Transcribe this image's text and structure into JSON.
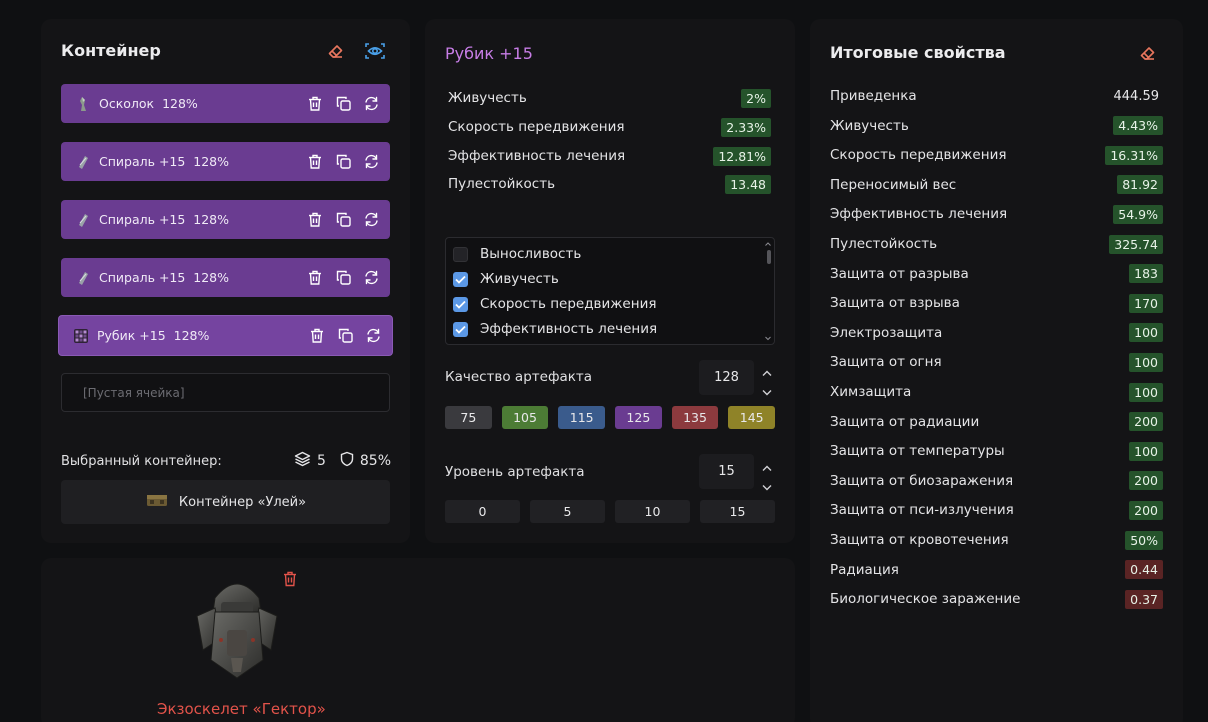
{
  "container": {
    "title": "Контейнер",
    "slots": [
      {
        "name": "Осколок",
        "percent": "128%"
      },
      {
        "name": "Спираль +15",
        "percent": "128%"
      },
      {
        "name": "Спираль +15",
        "percent": "128%"
      },
      {
        "name": "Спираль +15",
        "percent": "128%"
      },
      {
        "name": "Рубик +15",
        "percent": "128%"
      }
    ],
    "empty_slot": "[Пустая ячейка]",
    "selected_label": "Выбранный контейнер:",
    "capacity": "5",
    "protection": "85%",
    "container_name": "Контейнер «Улей»"
  },
  "artifact": {
    "title": "Рубик +15",
    "properties": [
      {
        "name": "Живучесть",
        "value": "2%"
      },
      {
        "name": "Скорость передвижения",
        "value": "2.33%"
      },
      {
        "name": "Эффективность лечения",
        "value": "12.81%"
      },
      {
        "name": "Пулестойкость",
        "value": "13.48"
      }
    ],
    "checklist": [
      {
        "label": "Выносливость",
        "checked": false
      },
      {
        "label": "Живучесть",
        "checked": true
      },
      {
        "label": "Скорость передвижения",
        "checked": true
      },
      {
        "label": "Эффективность лечения",
        "checked": true
      }
    ],
    "quality_label": "Качество артефакта",
    "quality_value": "128",
    "quality_presets": [
      {
        "label": "75",
        "color": "#3a3a3e"
      },
      {
        "label": "105",
        "color": "#4c7c35"
      },
      {
        "label": "115",
        "color": "#3a5b8c"
      },
      {
        "label": "125",
        "color": "#6a3c91"
      },
      {
        "label": "135",
        "color": "#8c3a3e"
      },
      {
        "label": "145",
        "color": "#8f8328"
      }
    ],
    "level_label": "Уровень артефакта",
    "level_value": "15",
    "level_presets": [
      "0",
      "5",
      "10",
      "15"
    ]
  },
  "totals": {
    "title": "Итоговые свойства",
    "rows": [
      {
        "name": "Приведенка",
        "value": "444.59",
        "style": "plain"
      },
      {
        "name": "Живучесть",
        "value": "4.43%",
        "style": "green"
      },
      {
        "name": "Скорость передвижения",
        "value": "16.31%",
        "style": "green"
      },
      {
        "name": "Переносимый вес",
        "value": "81.92",
        "style": "green"
      },
      {
        "name": "Эффективность лечения",
        "value": "54.9%",
        "style": "green"
      },
      {
        "name": "Пулестойкость",
        "value": "325.74",
        "style": "green"
      },
      {
        "name": "Защита от разрыва",
        "value": "183",
        "style": "green"
      },
      {
        "name": "Защита от взрыва",
        "value": "170",
        "style": "green"
      },
      {
        "name": "Электрозащита",
        "value": "100",
        "style": "green"
      },
      {
        "name": "Защита от огня",
        "value": "100",
        "style": "green"
      },
      {
        "name": "Химзащита",
        "value": "100",
        "style": "green"
      },
      {
        "name": "Защита от радиации",
        "value": "200",
        "style": "green"
      },
      {
        "name": "Защита от температуры",
        "value": "100",
        "style": "green"
      },
      {
        "name": "Защита от биозаражения",
        "value": "200",
        "style": "green"
      },
      {
        "name": "Защита от пси-излучения",
        "value": "200",
        "style": "green"
      },
      {
        "name": "Защита от кровотечения",
        "value": "50%",
        "style": "green"
      },
      {
        "name": "Радиация",
        "value": "0.44",
        "style": "red"
      },
      {
        "name": "Биологическое заражение",
        "value": "0.37",
        "style": "red"
      }
    ]
  },
  "suit": {
    "name": "Экзоскелет «Гектор»"
  },
  "colors": {
    "accent_purple": "#6a3c91",
    "title_purple": "#c77de6",
    "positive": "#25532b",
    "negative": "#5a2424",
    "eraser": "#e8765e",
    "eye": "#4aa0e8",
    "suit_name": "#e2534a"
  },
  "icons": {
    "eraser": "eraser-icon",
    "eye": "eye-icon",
    "trash": "trash-icon",
    "copy": "copy-icon",
    "swap": "refresh-icon",
    "layers": "layers-icon",
    "shield": "shield-icon"
  }
}
